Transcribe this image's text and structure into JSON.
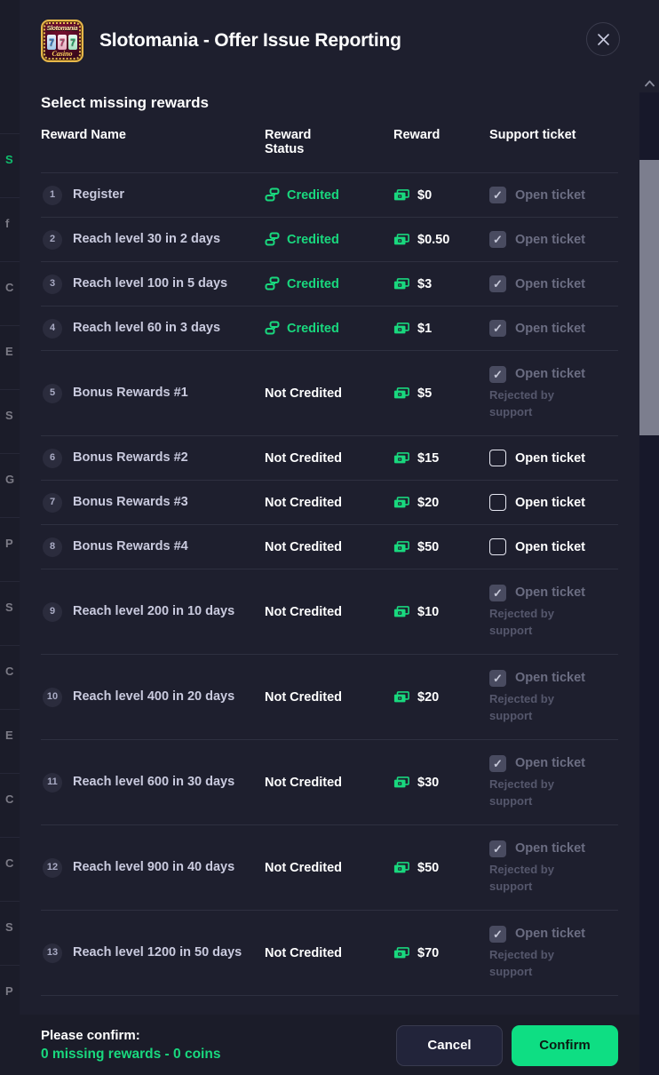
{
  "header": {
    "title": "Slotomania - Offer Issue Reporting",
    "logo_icon": "slotomania-casino-logo",
    "logo_brand": "Slotomania",
    "logo_reels": [
      "7",
      "7",
      "7"
    ],
    "logo_subtitle": "Casino",
    "close_icon": "close-icon"
  },
  "section": {
    "title": "Select missing rewards"
  },
  "table": {
    "columns": [
      "Reward Name",
      "Reward Status",
      "Reward",
      "Support ticket"
    ],
    "column_status_line1": "Reward",
    "column_status_line2": "Status",
    "credited_icon": "coin-stack-icon",
    "money_icon": "banknote-icon",
    "check_icon": "check-icon",
    "rows": [
      {
        "index": "1",
        "name": "Register",
        "status": "Credited",
        "credited": true,
        "reward": "$0",
        "ticket_label": "Open ticket",
        "checked": true,
        "disabled": true,
        "note": ""
      },
      {
        "index": "2",
        "name": "Reach level 30 in 2 days",
        "status": "Credited",
        "credited": true,
        "reward": "$0.50",
        "ticket_label": "Open ticket",
        "checked": true,
        "disabled": true,
        "note": ""
      },
      {
        "index": "3",
        "name": "Reach level 100 in 5 days",
        "status": "Credited",
        "credited": true,
        "reward": "$3",
        "ticket_label": "Open ticket",
        "checked": true,
        "disabled": true,
        "note": ""
      },
      {
        "index": "4",
        "name": "Reach level 60 in 3 days",
        "status": "Credited",
        "credited": true,
        "reward": "$1",
        "ticket_label": "Open ticket",
        "checked": true,
        "disabled": true,
        "note": ""
      },
      {
        "index": "5",
        "name": "Bonus Rewards #1",
        "status": "Not Credited",
        "credited": false,
        "reward": "$5",
        "ticket_label": "Open ticket",
        "checked": true,
        "disabled": true,
        "note": "Rejected by support"
      },
      {
        "index": "6",
        "name": "Bonus Rewards #2",
        "status": "Not Credited",
        "credited": false,
        "reward": "$15",
        "ticket_label": "Open ticket",
        "checked": false,
        "disabled": false,
        "note": ""
      },
      {
        "index": "7",
        "name": "Bonus Rewards #3",
        "status": "Not Credited",
        "credited": false,
        "reward": "$20",
        "ticket_label": "Open ticket",
        "checked": false,
        "disabled": false,
        "note": ""
      },
      {
        "index": "8",
        "name": "Bonus Rewards #4",
        "status": "Not Credited",
        "credited": false,
        "reward": "$50",
        "ticket_label": "Open ticket",
        "checked": false,
        "disabled": false,
        "note": ""
      },
      {
        "index": "9",
        "name": "Reach level 200 in 10 days",
        "status": "Not Credited",
        "credited": false,
        "reward": "$10",
        "ticket_label": "Open ticket",
        "checked": true,
        "disabled": true,
        "note": "Rejected by support"
      },
      {
        "index": "10",
        "name": "Reach level 400 in 20 days",
        "status": "Not Credited",
        "credited": false,
        "reward": "$20",
        "ticket_label": "Open ticket",
        "checked": true,
        "disabled": true,
        "note": "Rejected by support"
      },
      {
        "index": "11",
        "name": "Reach level 600 in 30 days",
        "status": "Not Credited",
        "credited": false,
        "reward": "$30",
        "ticket_label": "Open ticket",
        "checked": true,
        "disabled": true,
        "note": "Rejected by support"
      },
      {
        "index": "12",
        "name": "Reach level 900 in 40 days",
        "status": "Not Credited",
        "credited": false,
        "reward": "$50",
        "ticket_label": "Open ticket",
        "checked": true,
        "disabled": true,
        "note": "Rejected by support"
      },
      {
        "index": "13",
        "name": "Reach level 1200 in 50 days",
        "status": "Not Credited",
        "credited": false,
        "reward": "$70",
        "ticket_label": "Open ticket",
        "checked": true,
        "disabled": true,
        "note": "Rejected by support"
      }
    ]
  },
  "footer": {
    "confirm_label": "Please confirm:",
    "confirm_summary": "0 missing rewards - 0 coins",
    "cancel_label": "Cancel",
    "confirm_button_label": "Confirm"
  },
  "scrollbar": {
    "up_arrow_icon": "chevron-up-icon"
  },
  "backdrop": {
    "ghost_letters": [
      "S",
      "f",
      "C",
      "E",
      "S",
      "G",
      "P",
      "S",
      "C",
      "E",
      "C",
      "C",
      "S",
      "P"
    ]
  },
  "colors": {
    "accent_green": "#19d87e",
    "confirm_green": "#0ede83",
    "modal_bg": "#1e1f2e",
    "footer_bg": "#1b1c29",
    "divider": "#2e3040",
    "name_text": "#c9cade",
    "muted_text": "#6b6d82"
  }
}
